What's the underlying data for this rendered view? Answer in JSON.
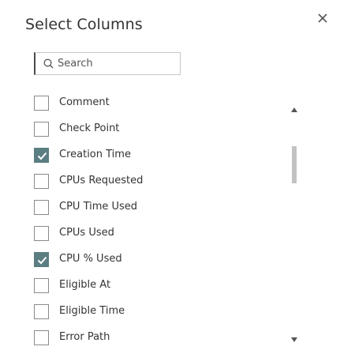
{
  "dialog": {
    "title": "Select Columns",
    "close_icon": "close-icon"
  },
  "search": {
    "placeholder": "Search",
    "value": "",
    "icon": "search-icon"
  },
  "columns": [
    {
      "label": "Comment",
      "checked": false
    },
    {
      "label": "Check Point",
      "checked": false
    },
    {
      "label": "Creation Time",
      "checked": true
    },
    {
      "label": "CPUs Requested",
      "checked": false
    },
    {
      "label": "CPU Time Used",
      "checked": false
    },
    {
      "label": "CPUs Used",
      "checked": false
    },
    {
      "label": "CPU % Used",
      "checked": true
    },
    {
      "label": "Eligible At",
      "checked": false
    },
    {
      "label": "Eligible Time",
      "checked": false
    },
    {
      "label": "Error Path",
      "checked": false
    }
  ],
  "scrollbar": {
    "up_icon": "caret-up-icon",
    "down_icon": "caret-down-icon"
  },
  "colors": {
    "checked_fill": "#5b7e82",
    "text": "#333333",
    "border": "#8a8a8a",
    "thumb": "#c2c2c2"
  }
}
